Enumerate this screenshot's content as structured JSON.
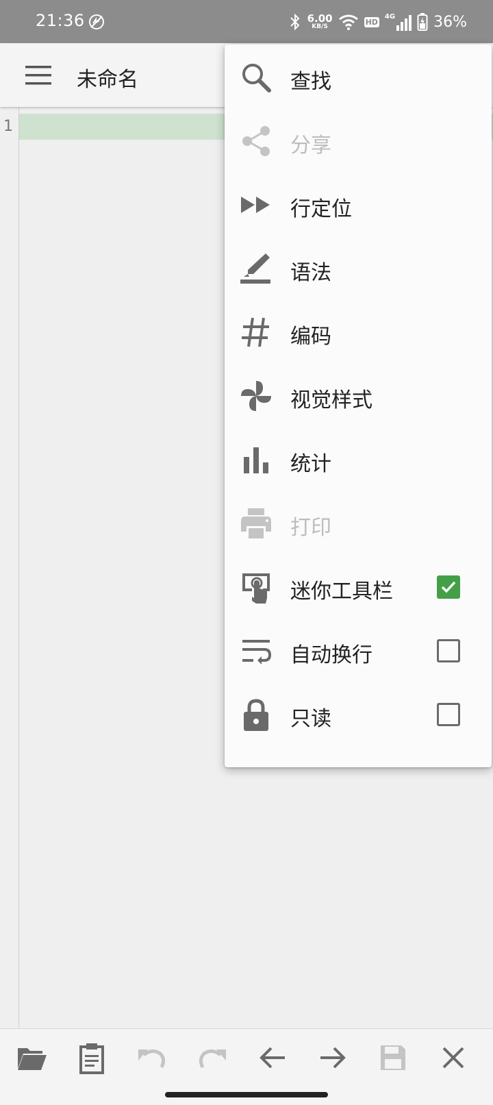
{
  "status_bar": {
    "time": "21:36",
    "net_speed_value": "6.00",
    "net_speed_unit": "KB/S",
    "hd_badge": "HD",
    "network_type": "4G",
    "battery": "36%"
  },
  "app_bar": {
    "title": "未命名",
    "menu_icon": "hamburger-menu-icon"
  },
  "editor": {
    "line_numbers": [
      "1"
    ],
    "current_line_color": "#cfe2cf"
  },
  "overflow_menu": {
    "items": [
      {
        "label": "查找",
        "icon": "search-icon",
        "enabled": true
      },
      {
        "label": "分享",
        "icon": "share-icon",
        "enabled": false
      },
      {
        "label": "行定位",
        "icon": "fast-forward-icon",
        "enabled": true
      },
      {
        "label": "语法",
        "icon": "highlighter-icon",
        "enabled": true
      },
      {
        "label": "编码",
        "icon": "hash-icon",
        "enabled": true
      },
      {
        "label": "视觉样式",
        "icon": "pinwheel-icon",
        "enabled": true
      },
      {
        "label": "统计",
        "icon": "bar-chart-icon",
        "enabled": true
      },
      {
        "label": "打印",
        "icon": "printer-icon",
        "enabled": false
      },
      {
        "label": "迷你工具栏",
        "icon": "touch-screen-icon",
        "enabled": true,
        "checkbox": true,
        "checked": true
      },
      {
        "label": "自动换行",
        "icon": "wrap-text-icon",
        "enabled": true,
        "checkbox": true,
        "checked": false
      },
      {
        "label": "只读",
        "icon": "lock-icon",
        "enabled": true,
        "checkbox": true,
        "checked": false
      }
    ]
  },
  "bottom_toolbar": {
    "buttons": [
      {
        "icon": "folder-open-icon",
        "enabled": true
      },
      {
        "icon": "clipboard-icon",
        "enabled": true
      },
      {
        "icon": "undo-icon",
        "enabled": false
      },
      {
        "icon": "redo-icon",
        "enabled": false
      },
      {
        "icon": "arrow-left-icon",
        "enabled": true
      },
      {
        "icon": "arrow-right-icon",
        "enabled": true
      },
      {
        "icon": "save-icon",
        "enabled": false
      },
      {
        "icon": "close-icon",
        "enabled": true
      }
    ]
  },
  "colors": {
    "status_bar": "#8c8c8c",
    "icon": "#6a6a6a",
    "icon_disabled": "#c4c4c4",
    "checkbox_checked": "#43a047"
  }
}
